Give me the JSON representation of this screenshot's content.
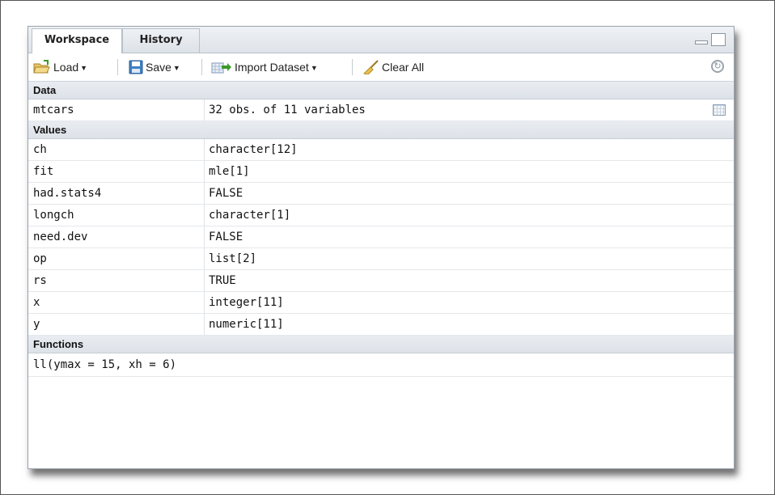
{
  "tabs": [
    {
      "label": "Workspace",
      "active": true
    },
    {
      "label": "History",
      "active": false
    }
  ],
  "toolbar": {
    "load_label": "Load",
    "save_label": "Save",
    "import_label": "Import Dataset",
    "clear_label": "Clear All"
  },
  "sections": {
    "data_header": "Data",
    "values_header": "Values",
    "functions_header": "Functions"
  },
  "data_rows": [
    {
      "name": "mtcars",
      "value": "32 obs. of 11 variables"
    }
  ],
  "value_rows": [
    {
      "name": "ch",
      "value": "character[12]"
    },
    {
      "name": "fit",
      "value": "mle[1]"
    },
    {
      "name": "had.stats4",
      "value": "FALSE"
    },
    {
      "name": "longch",
      "value": "character[1]"
    },
    {
      "name": "need.dev",
      "value": "FALSE"
    },
    {
      "name": "op",
      "value": "list[2]"
    },
    {
      "name": "rs",
      "value": "TRUE"
    },
    {
      "name": "x",
      "value": "integer[11]"
    },
    {
      "name": "y",
      "value": "numeric[11]"
    }
  ],
  "function_rows": [
    {
      "signature": "ll(ymax = 15, xh = 6)"
    }
  ],
  "icons": {
    "load": "folder-open-icon",
    "save": "floppy-disk-icon",
    "import": "import-dataset-icon",
    "clear": "broom-icon",
    "refresh": "refresh-icon",
    "view_data": "table-grid-icon"
  },
  "colors": {
    "tab_bar": "#e4e8ee",
    "section_header": "#e3e7ec",
    "border": "#9aa3ad"
  }
}
